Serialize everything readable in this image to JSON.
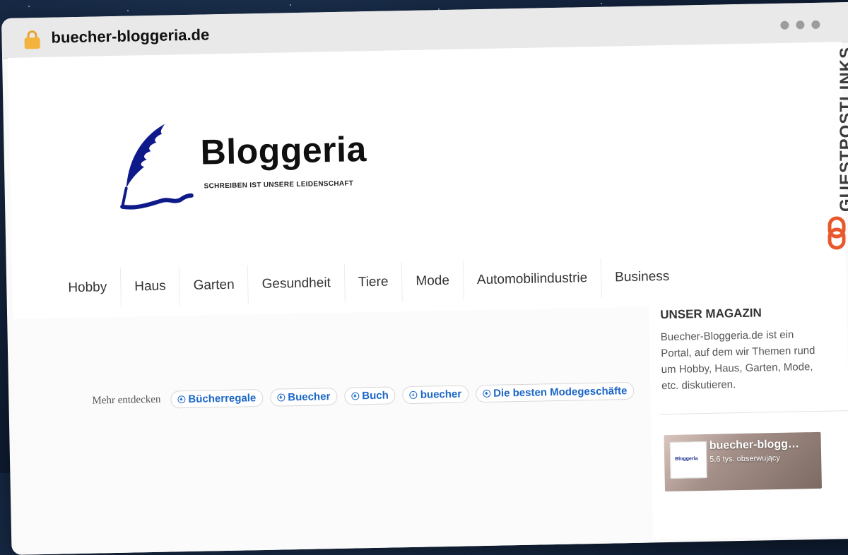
{
  "browser": {
    "url": "buecher-bloggeria.de"
  },
  "logo": {
    "title": "Bloggeria",
    "tagline": "SCHREIBEN IST UNSERE LEIDENSCHAFT",
    "color": "#0f1a8a"
  },
  "nav": {
    "items": [
      "Hobby",
      "Haus",
      "Garten",
      "Gesundheit",
      "Tiere",
      "Mode",
      "Automobilindustrie",
      "Business"
    ]
  },
  "discover": {
    "label": "Mehr entdecken",
    "chips": [
      "Bücherregale",
      "Buecher",
      "Buch",
      "buecher",
      "Die besten Modegeschäfte"
    ]
  },
  "sidebar": {
    "title": "UNSER MAGAZIN",
    "text": "Buecher-Bloggeria.de ist ein Portal, auf dem wir Themen rund um Hobby, Haus, Garten, Mode, etc. diskutieren.",
    "facebook": {
      "name": "buecher-blogg…",
      "followers": "5,6 tys. obserwujący",
      "thumb_label": "Bloggeria"
    }
  },
  "watermark": {
    "text": "GUESTPOSTLINKS",
    "accent": "#e8582a"
  }
}
